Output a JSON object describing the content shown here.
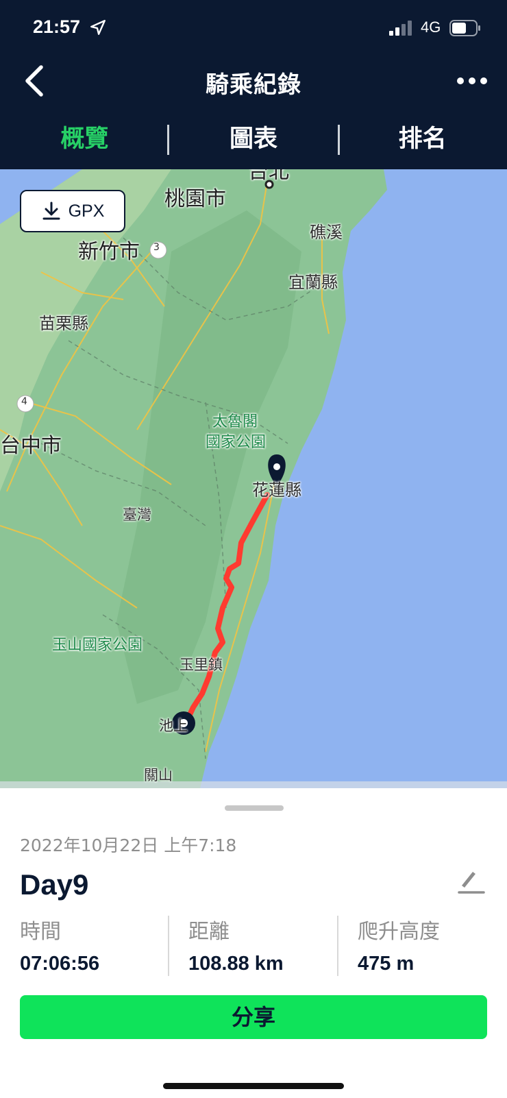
{
  "status_bar": {
    "time": "21:57",
    "network": "4G"
  },
  "header": {
    "title": "騎乘紀錄"
  },
  "tabs": [
    {
      "label": "概覽",
      "active": true
    },
    {
      "label": "圖表",
      "active": false
    },
    {
      "label": "排名",
      "active": false
    }
  ],
  "map": {
    "gpx_button": "GPX",
    "labels": {
      "taipei": "台北",
      "taoyuan": "桃園市",
      "hsinchu": "新竹市",
      "jiaoxi": "礁溪",
      "yilan": "宜蘭縣",
      "miaoli": "苗栗縣",
      "taichung": "台中市",
      "taroko": "太魯閣",
      "taroko2": "國家公園",
      "hualien": "花蓮縣",
      "taiwan": "臺灣",
      "yushan": "玉山國家公園",
      "yuli": "玉里鎮",
      "chishang": "池上",
      "guanshan": "關山",
      "road3": "3",
      "road4": "4"
    }
  },
  "ride": {
    "date": "2022年10月22日 上午7:18",
    "name": "Day9",
    "stats": [
      {
        "label": "時間",
        "value": "07:06:56"
      },
      {
        "label": "距離",
        "value": "108.88 km"
      },
      {
        "label": "爬升高度",
        "value": "475 m"
      }
    ],
    "share_label": "分享"
  },
  "colors": {
    "header_bg": "#0b1931",
    "accent_green": "#27d066",
    "share_green": "#0fe35a",
    "route_red": "#ff3b30",
    "sea": "#8fb3f0",
    "land": "#8cc496"
  },
  "icons": [
    "location-arrow-icon",
    "signal-icon",
    "battery-icon",
    "back-icon",
    "more-icon",
    "download-icon",
    "pin-icon",
    "edit-icon"
  ]
}
